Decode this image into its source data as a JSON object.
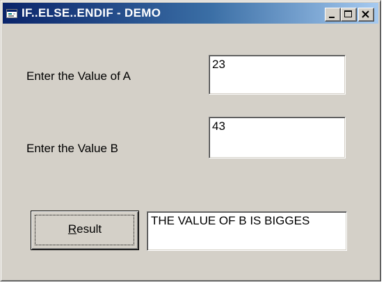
{
  "window": {
    "title": "IF..ELSE..ENDIF - DEMO",
    "icon": "vb-form-icon"
  },
  "titlebar_buttons": {
    "minimize": "minimize-icon",
    "maximize": "maximize-icon",
    "close": "close-icon"
  },
  "form": {
    "label_a": "Enter the Value of A",
    "value_a": "23",
    "label_b": "Enter the Value B",
    "value_b": "43",
    "result_button": {
      "mnemonic": "R",
      "rest": "esult"
    },
    "result_value": "THE VALUE OF B IS BIGGES"
  },
  "colors": {
    "title_gradient_start": "#0a246a",
    "title_gradient_end": "#a6caf0",
    "face": "#d4d0c8"
  }
}
